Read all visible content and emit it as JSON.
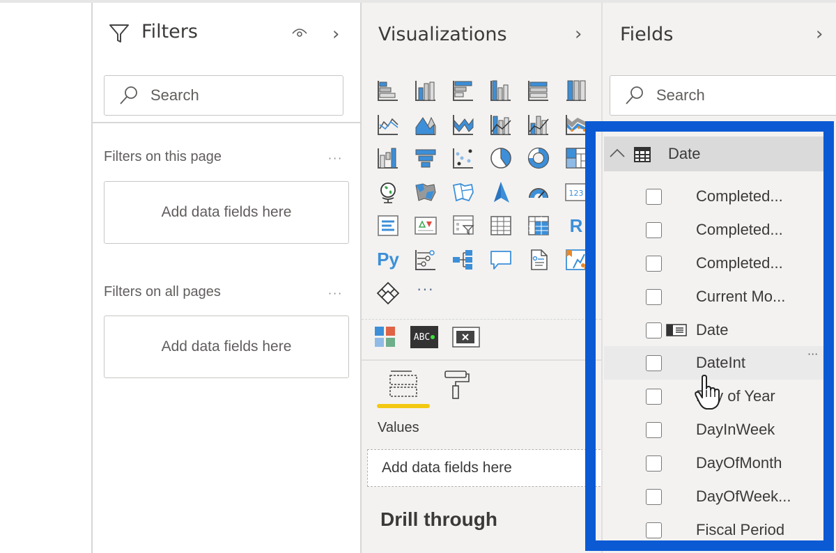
{
  "filters_pane": {
    "title": "Filters",
    "search_placeholder": "Search",
    "sections": [
      {
        "label": "Filters on this page",
        "drop_text": "Add data fields here"
      },
      {
        "label": "Filters on all pages",
        "drop_text": "Add data fields here"
      }
    ],
    "more_label": "···"
  },
  "visualizations_pane": {
    "title": "Visualizations",
    "visual_icons": [
      "stacked-bar-chart-icon",
      "stacked-column-chart-icon",
      "clustered-bar-chart-icon",
      "clustered-column-chart-icon",
      "100-stacked-bar-chart-icon",
      "100-stacked-column-chart-icon",
      "line-chart-icon",
      "area-chart-icon",
      "stacked-area-chart-icon",
      "line-and-stacked-column-icon",
      "line-and-clustered-column-icon",
      "ribbon-chart-icon",
      "waterfall-chart-icon",
      "funnel-icon",
      "scatter-chart-icon",
      "pie-chart-icon",
      "donut-chart-icon",
      "treemap-icon",
      "map-icon",
      "filled-map-icon",
      "shape-map-icon",
      "azure-map-icon",
      "gauge-icon",
      "card-icon",
      "multi-row-card-icon",
      "kpi-icon",
      "slicer-icon",
      "table-icon",
      "matrix-icon",
      "r-script-visual-icon",
      "python-visual-icon",
      "key-influencers-icon",
      "decomposition-tree-icon",
      "qa-icon",
      "smart-narrative-icon",
      "paginated-report-icon",
      "power-apps-icon",
      "more-visuals-icon"
    ],
    "r_label": "R",
    "py_label": "Py",
    "more_label": "···",
    "custom_visuals": [
      "custom-visual-tiles-icon",
      "custom-visual-text-icon",
      "custom-visual-close-icon"
    ],
    "custom_text_label": "ABC",
    "tabs": [
      "fields-tab",
      "format-tab"
    ],
    "active_tab": "fields-tab",
    "values_label": "Values",
    "values_drop_text": "Add data fields here",
    "drill_through_title": "Drill through"
  },
  "fields_pane": {
    "title": "Fields",
    "search_placeholder": "Search",
    "table": {
      "name": "Date",
      "expanded": true,
      "fields": [
        {
          "name": "Completed...",
          "checked": false,
          "hierarchy": false
        },
        {
          "name": "Completed...",
          "checked": false,
          "hierarchy": false
        },
        {
          "name": "Completed...",
          "checked": false,
          "hierarchy": false
        },
        {
          "name": "Current Mo...",
          "checked": false,
          "hierarchy": false
        },
        {
          "name": "Date",
          "checked": false,
          "hierarchy": true
        },
        {
          "name": "DateInt",
          "checked": false,
          "hierarchy": false,
          "hovered": true
        },
        {
          "name": "Day of Year",
          "checked": false,
          "hierarchy": false
        },
        {
          "name": "DayInWeek",
          "checked": false,
          "hierarchy": false
        },
        {
          "name": "DayOfMonth",
          "checked": false,
          "hierarchy": false
        },
        {
          "name": "DayOfWeek...",
          "checked": false,
          "hierarchy": false
        },
        {
          "name": "Fiscal Period",
          "checked": false,
          "hierarchy": false
        }
      ]
    },
    "hover_more_label": "···"
  },
  "colors": {
    "highlight_border": "#0b5ad4",
    "active_tab_underline": "#f2c811",
    "pane_background": "#f3f2f1",
    "visual_accent": "#3c8fd8"
  }
}
